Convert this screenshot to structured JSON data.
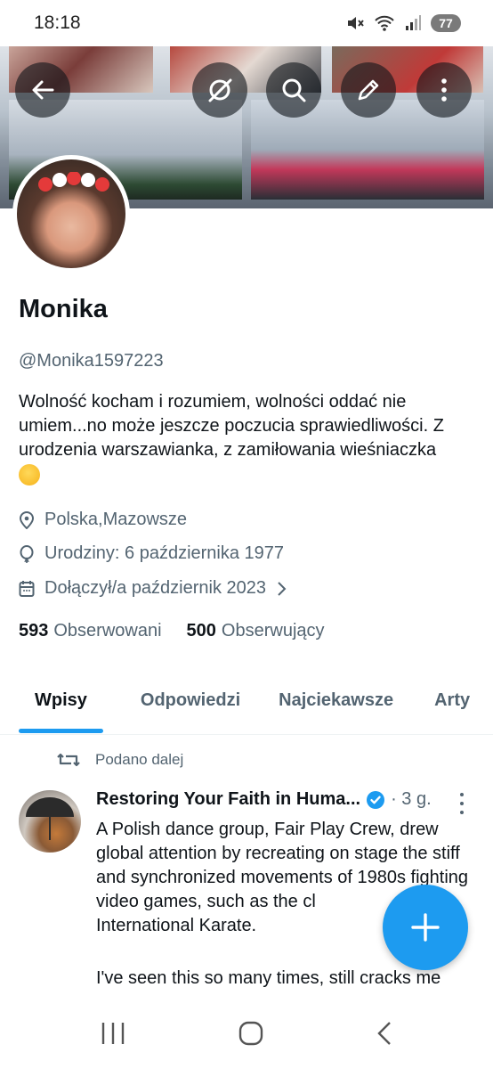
{
  "status_bar": {
    "time": "18:18",
    "battery": "77"
  },
  "header_buttons": [
    "back-arrow-icon",
    "grok-icon",
    "search-icon",
    "edit-icon",
    "more-vertical-icon"
  ],
  "profile": {
    "name": "Monika",
    "handle": "@Monika1597223",
    "bio": "Wolność kocham i rozumiem, wolności oddać nie umiem...no może jeszcze poczucia sprawiedliwości. Z urodzenia warszawianka, z zamiłowania wieśniaczka",
    "location": "Polska,Mazowsze",
    "birthday": "Urodziny: 6 października 1977",
    "joined": "Dołączył/a październik 2023",
    "following_count": "593",
    "following_label": "Obserwowani",
    "followers_count": "500",
    "followers_label": "Obserwujący"
  },
  "tabs": [
    {
      "label": "Wpisy",
      "active": true
    },
    {
      "label": "Odpowiedzi",
      "active": false
    },
    {
      "label": "Najciekawsze",
      "active": false
    },
    {
      "label": "Arty",
      "active": false
    }
  ],
  "tweet": {
    "repost_label": "Podano dalej",
    "author": "Restoring Your Faith in Huma...",
    "time": "· 3 g.",
    "text": "A Polish dance group, Fair Play Crew, drew global attention by recreating on stage the stiff and synchronized movements of 1980s fighting video games, such as the cl",
    "text_continuation": "International Karate.",
    "text2": "I've seen this so many times, still cracks me"
  },
  "colors": {
    "accent": "#1d9bf0",
    "text": "#0f1419",
    "secondary": "#536471"
  }
}
